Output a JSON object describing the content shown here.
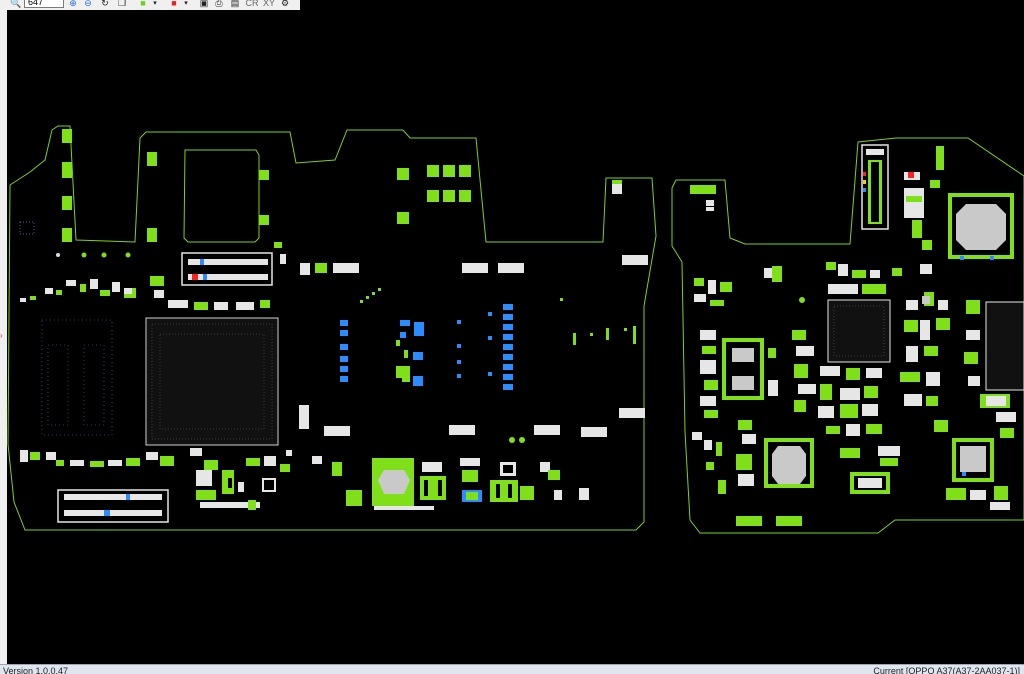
{
  "toolbar": {
    "zoom_value": "647",
    "buttons": [
      {
        "name": "search-icon",
        "glyph": "🔍",
        "interactable": true
      },
      {
        "name": "zoom-in-icon",
        "glyph": "⊕",
        "interactable": true
      },
      {
        "name": "zoom-out-icon",
        "glyph": "⊖",
        "interactable": true
      },
      {
        "name": "refresh-icon",
        "glyph": "↻",
        "interactable": true
      },
      {
        "name": "copy-icon",
        "glyph": "❐",
        "interactable": true
      },
      {
        "name": "green-color-picker",
        "glyph": "■",
        "interactable": true
      },
      {
        "name": "red-color-picker",
        "glyph": "■",
        "interactable": true
      },
      {
        "name": "screenshot-icon",
        "glyph": "▣",
        "interactable": true
      },
      {
        "name": "print-icon",
        "glyph": "⎙",
        "interactable": true
      },
      {
        "name": "document-icon",
        "glyph": "▤",
        "interactable": true
      },
      {
        "name": "cr-label",
        "glyph": "CR",
        "interactable": true
      },
      {
        "name": "xy-label",
        "glyph": "XY",
        "interactable": true
      },
      {
        "name": "settings-icon",
        "glyph": "⚙",
        "interactable": true
      }
    ]
  },
  "status": {
    "version": "Version 1.0.0.47",
    "current": "Current [OPPO A37(A37-2AA037-1)]"
  },
  "colors": {
    "outline": "#7fd11a",
    "pad_green": "#7fe01a",
    "pad_white": "#e6e6e6",
    "pad_blue": "#2a8cff",
    "pad_red": "#ff2020",
    "chip": "#c9c9c9"
  }
}
